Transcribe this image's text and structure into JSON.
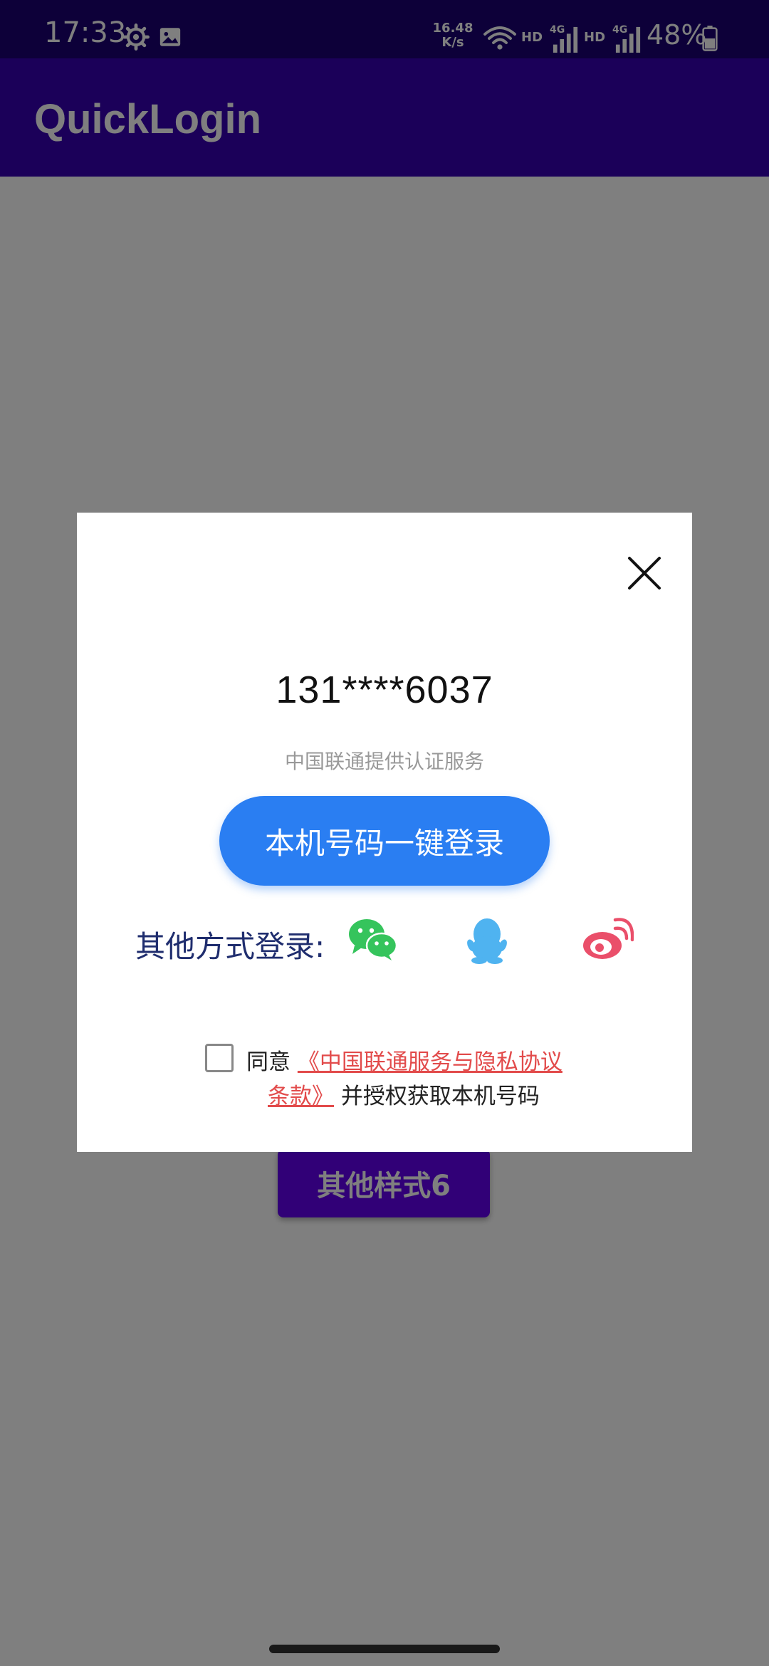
{
  "status_bar": {
    "time": "17:33",
    "net_speed_value": "16.48",
    "net_speed_unit": "K/s",
    "hd_1": "HD",
    "hd_2": "HD",
    "network_1": "4G",
    "network_2": "4G",
    "battery": "48%",
    "icons": [
      "gear-icon",
      "image-icon",
      "wifi-icon",
      "signal-icon",
      "battery-icon"
    ]
  },
  "app_bar": {
    "title": "QuickLogin"
  },
  "background": {
    "button_label": "其他样式6"
  },
  "dialog": {
    "phone_number": "131****6037",
    "service_text": "中国联通提供认证服务",
    "login_button": "本机号码一键登录",
    "other_methods_label": "其他方式登录:",
    "social_icons": [
      "wechat-icon",
      "qq-icon",
      "weibo-icon"
    ],
    "agreement": {
      "checked": false,
      "prefix": "同意 ",
      "link_part1": "《中国联通服务与隐私协议",
      "link_part2": "条款》",
      "suffix": " 并授权获取本机号码"
    }
  },
  "colors": {
    "status_bar": "#1a0072",
    "app_bar": "#3700b3",
    "primary_button": "#2a7ef2",
    "link": "#e24b4b",
    "wechat": "#35c45c",
    "qq": "#4fb3f0",
    "weibo": "#ea4f6a"
  }
}
